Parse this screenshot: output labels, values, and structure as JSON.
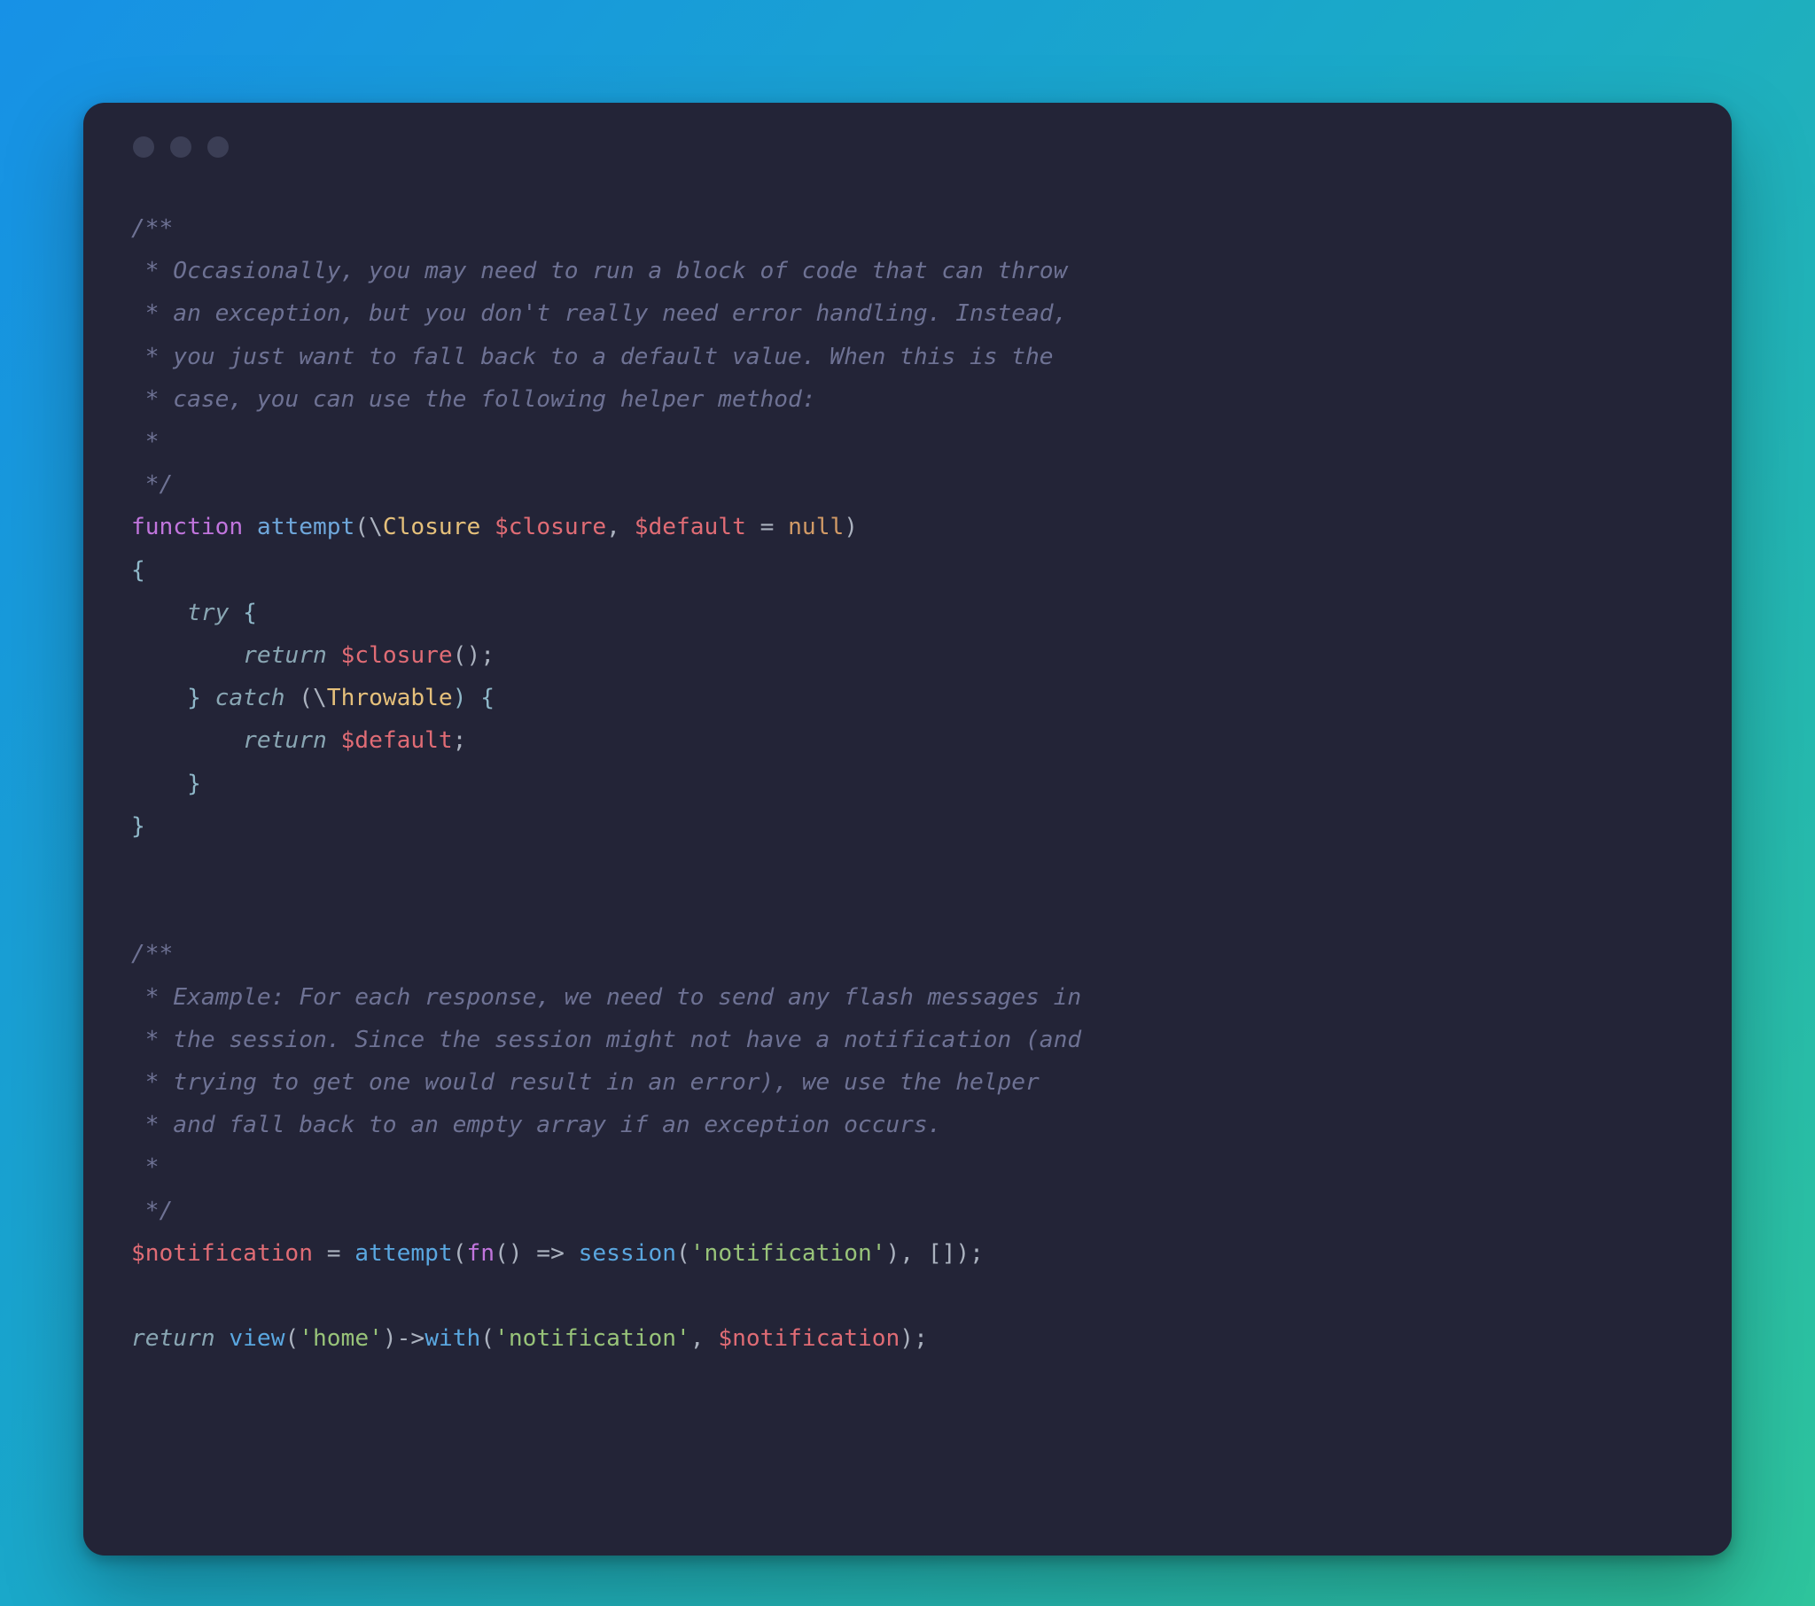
{
  "code": {
    "l1": "/**",
    "l2": " * Occasionally, you may need to run a block of code that can throw",
    "l3": " * an exception, but you don't really need error handling. Instead,",
    "l4": " * you just want to fall back to a default value. When this is the",
    "l5": " * case, you can use the following helper method:",
    "l6": " *",
    "l7": " */",
    "l8_kw": "function",
    "l8_fn": "attempt",
    "l8_open": "(",
    "l8_ns": "\\",
    "l8_cls": "Closure",
    "l8_sp1": " ",
    "l8_var1": "$closure",
    "l8_comma": ", ",
    "l8_var2": "$default",
    "l8_eq": " = ",
    "l8_null": "null",
    "l8_close": ")",
    "l9": "{",
    "l10_pad": "    ",
    "l10_try": "try",
    "l10_brace": " {",
    "l11_pad": "        ",
    "l11_return": "return",
    "l11_sp": " ",
    "l11_var": "$closure",
    "l11_parens": "();",
    "l12_pad": "    ",
    "l12_rbrace": "} ",
    "l12_catch": "catch",
    "l12_open": " (",
    "l12_ns": "\\",
    "l12_cls": "Throwable",
    "l12_close": ") {",
    "l13_pad": "        ",
    "l13_return": "return",
    "l13_sp": " ",
    "l13_var": "$default",
    "l13_semi": ";",
    "l14_pad": "    ",
    "l14_rbrace": "}",
    "l15": "}",
    "blank1": "",
    "blank2": "",
    "l16": "/**",
    "l17": " * Example: For each response, we need to send any flash messages in",
    "l18": " * the session. Since the session might not have a notification (and",
    "l19": " * trying to get one would result in an error), we use the helper",
    "l20": " * and fall back to an empty array if an exception occurs.",
    "l21": " *",
    "l22": " */",
    "l23_var": "$notification",
    "l23_eq": " = ",
    "l23_fn": "attempt",
    "l23_open": "(",
    "l23_kwfn": "fn",
    "l23_paren": "() ",
    "l23_arrow": "=>",
    "l23_sp": " ",
    "l23_sess": "session",
    "l23_sopen": "(",
    "l23_str": "'notification'",
    "l23_sclose": "), []);",
    "blank3": "",
    "l24_ret": "return",
    "l24_sp": " ",
    "l24_view": "view",
    "l24_vopen": "(",
    "l24_vstr": "'home'",
    "l24_vclose": ")",
    "l24_arrow": "->",
    "l24_with": "with",
    "l24_wopen": "(",
    "l24_wstr": "'notification'",
    "l24_comma": ", ",
    "l24_var": "$notification",
    "l24_wclose": ");"
  }
}
